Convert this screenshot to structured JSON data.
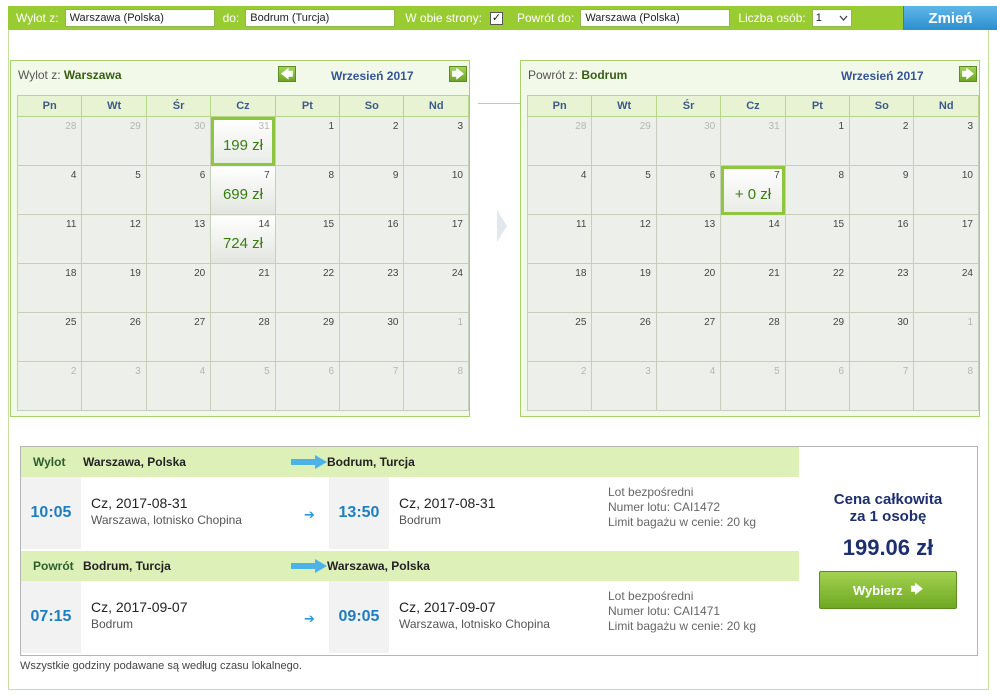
{
  "search": {
    "from_label": "Wylot z:",
    "from_value": "Warszawa (Polska)",
    "to_label": "do:",
    "to_value": "Bodrum (Turcja)",
    "both_ways_label": "W obie strony:",
    "both_ways_checked": "✓",
    "return_label": "Powrót do:",
    "return_value": "Warszawa (Polska)",
    "persons_label": "Liczba osób:",
    "persons_value": "1",
    "change_label": "Zmień"
  },
  "weekdays": [
    "Pn",
    "Wt",
    "Śr",
    "Cz",
    "Pt",
    "So",
    "Nd"
  ],
  "outbound_calendar": {
    "title_prefix": "Wylot z:",
    "title_city": "Warszawa",
    "month": "Wrzesień 2017",
    "prev_icon": "🡄",
    "next_icon": "🡆",
    "weeks": [
      [
        {
          "d": "28",
          "o": true
        },
        {
          "d": "29",
          "o": true
        },
        {
          "d": "30",
          "o": true
        },
        {
          "d": "31",
          "o": true,
          "price": "199 zł",
          "selected": true
        },
        {
          "d": "1"
        },
        {
          "d": "2"
        },
        {
          "d": "3"
        }
      ],
      [
        {
          "d": "4"
        },
        {
          "d": "5"
        },
        {
          "d": "6"
        },
        {
          "d": "7",
          "price": "699 zł"
        },
        {
          "d": "8"
        },
        {
          "d": "9"
        },
        {
          "d": "10"
        }
      ],
      [
        {
          "d": "11"
        },
        {
          "d": "12"
        },
        {
          "d": "13"
        },
        {
          "d": "14",
          "price": "724 zł"
        },
        {
          "d": "15"
        },
        {
          "d": "16"
        },
        {
          "d": "17"
        }
      ],
      [
        {
          "d": "18"
        },
        {
          "d": "19"
        },
        {
          "d": "20"
        },
        {
          "d": "21"
        },
        {
          "d": "22"
        },
        {
          "d": "23"
        },
        {
          "d": "24"
        }
      ],
      [
        {
          "d": "25"
        },
        {
          "d": "26"
        },
        {
          "d": "27"
        },
        {
          "d": "28"
        },
        {
          "d": "29"
        },
        {
          "d": "30"
        },
        {
          "d": "1",
          "o": true
        }
      ],
      [
        {
          "d": "2",
          "o": true
        },
        {
          "d": "3",
          "o": true
        },
        {
          "d": "4",
          "o": true
        },
        {
          "d": "5",
          "o": true
        },
        {
          "d": "6",
          "o": true
        },
        {
          "d": "7",
          "o": true
        },
        {
          "d": "8",
          "o": true
        }
      ]
    ]
  },
  "return_calendar": {
    "title_prefix": "Powrót z:",
    "title_city": "Bodrum",
    "month": "Wrzesień 2017",
    "next_icon": "🡆",
    "weeks": [
      [
        {
          "d": "28",
          "o": true
        },
        {
          "d": "29",
          "o": true
        },
        {
          "d": "30",
          "o": true
        },
        {
          "d": "31",
          "o": true
        },
        {
          "d": "1"
        },
        {
          "d": "2"
        },
        {
          "d": "3"
        }
      ],
      [
        {
          "d": "4"
        },
        {
          "d": "5"
        },
        {
          "d": "6"
        },
        {
          "d": "7",
          "price": "+ 0 zł",
          "selected": true
        },
        {
          "d": "8"
        },
        {
          "d": "9"
        },
        {
          "d": "10"
        }
      ],
      [
        {
          "d": "11"
        },
        {
          "d": "12"
        },
        {
          "d": "13"
        },
        {
          "d": "14"
        },
        {
          "d": "15"
        },
        {
          "d": "16"
        },
        {
          "d": "17"
        }
      ],
      [
        {
          "d": "18"
        },
        {
          "d": "19"
        },
        {
          "d": "20"
        },
        {
          "d": "21"
        },
        {
          "d": "22"
        },
        {
          "d": "23"
        },
        {
          "d": "24"
        }
      ],
      [
        {
          "d": "25"
        },
        {
          "d": "26"
        },
        {
          "d": "27"
        },
        {
          "d": "28"
        },
        {
          "d": "29"
        },
        {
          "d": "30"
        },
        {
          "d": "1",
          "o": true
        }
      ],
      [
        {
          "d": "2",
          "o": true
        },
        {
          "d": "3",
          "o": true
        },
        {
          "d": "4",
          "o": true
        },
        {
          "d": "5",
          "o": true
        },
        {
          "d": "6",
          "o": true
        },
        {
          "d": "7",
          "o": true
        },
        {
          "d": "8",
          "o": true
        }
      ]
    ]
  },
  "outbound": {
    "type": "Wylot",
    "from": "Warszawa, Polska",
    "to": "Bodrum, Turcja",
    "dep_time": "10:05",
    "dep_date": "Cz, 2017-08-31",
    "dep_place": "Warszawa, lotnisko Chopina",
    "arr_time": "13:50",
    "arr_date": "Cz, 2017-08-31",
    "arr_place": "Bodrum",
    "direct": "Lot bezpośredni",
    "flight_no": "Numer lotu: CAI1472",
    "baggage": "Limit bagażu w cenie: 20 kg"
  },
  "inbound": {
    "type": "Powrót",
    "from": "Bodrum, Turcja",
    "to": "Warszawa, Polska",
    "dep_time": "07:15",
    "dep_date": "Cz, 2017-09-07",
    "dep_place": "Bodrum",
    "arr_time": "09:05",
    "arr_date": "Cz, 2017-09-07",
    "arr_place": "Warszawa, lotnisko Chopina",
    "direct": "Lot bezpośredni",
    "flight_no": "Numer lotu: CAI1471",
    "baggage": "Limit bagażu w cenie: 20 kg"
  },
  "total": {
    "label_line1": "Cena całkowita",
    "label_line2": "za 1 osobę",
    "price": "199.06 zł",
    "choose_label": "Wybierz",
    "choose_icon": "🡆"
  },
  "footnote": "Wszystkie godziny podawane są według czasu lokalnego.",
  "small_arrow": "➔"
}
